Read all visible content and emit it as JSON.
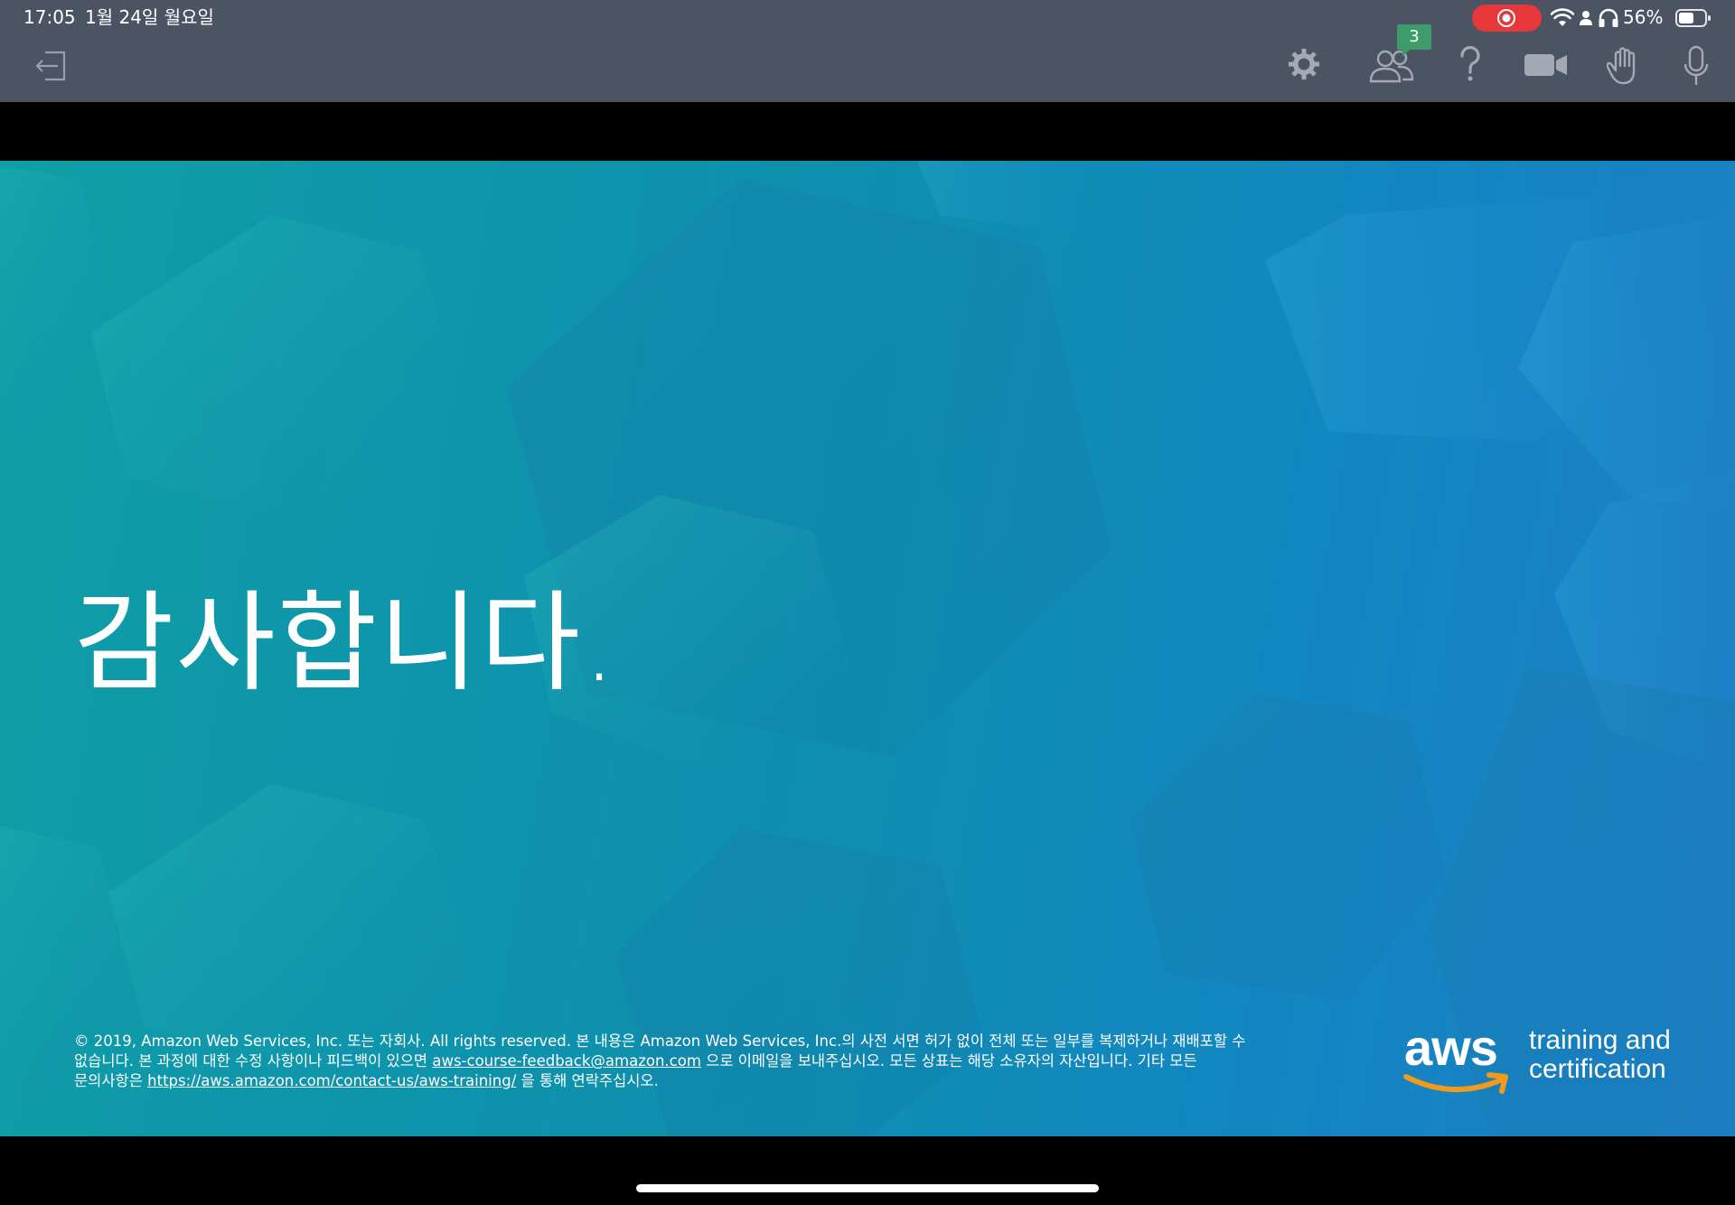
{
  "status_bar": {
    "time": "17:05",
    "date": "1월 24일 월요일",
    "battery": "56%",
    "icons": [
      "screen-record-icon",
      "wifi-icon",
      "person-icon",
      "headphones-icon",
      "battery-icon"
    ]
  },
  "toolbar": {
    "exit_icon": "exit-icon",
    "settings_icon": "gear-icon",
    "participants_icon": "participants-icon",
    "participants_count": "3",
    "help_icon": "help-icon",
    "video_icon": "video-camera-icon",
    "raise_hand_icon": "raise-hand-icon",
    "mic_icon": "microphone-icon"
  },
  "slide": {
    "title": "감사합니다.",
    "legal_line1": "© 2019, Amazon Web Services, Inc. 또는 자회사. All rights reserved. 본 내용은 Amazon Web Services, Inc.의 사전 서면 허가 없이 전체 또는 일부를 복제하거나 재배포할 수",
    "legal_line2_prefix": "없습니다. 본 과정에 대한 수정 사항이나 피드백이 있으면 ",
    "feedback_email": "aws-course-feedback@amazon.com",
    "legal_line2_suffix": " 으로 이메일을 보내주십시오. 모든 상표는 해당 소유자의 자산입니다. 기타 모든",
    "legal_line3_prefix": "문의사항은 ",
    "contact_url": "https://aws.amazon.com/contact-us/aws-training/",
    "legal_line3_suffix": " 을 통해 연락주십시오.",
    "logo_wordmark": "aws",
    "logo_tagline_1": "training and",
    "logo_tagline_2": "certification"
  },
  "colors": {
    "toolbar_bg": "#4c5363",
    "record_red": "#e8373a",
    "badge_green": "#3e9b6a",
    "aws_orange": "#f29a1b",
    "slide_teal": "#0f9ea6",
    "slide_blue": "#1d7fc6"
  }
}
